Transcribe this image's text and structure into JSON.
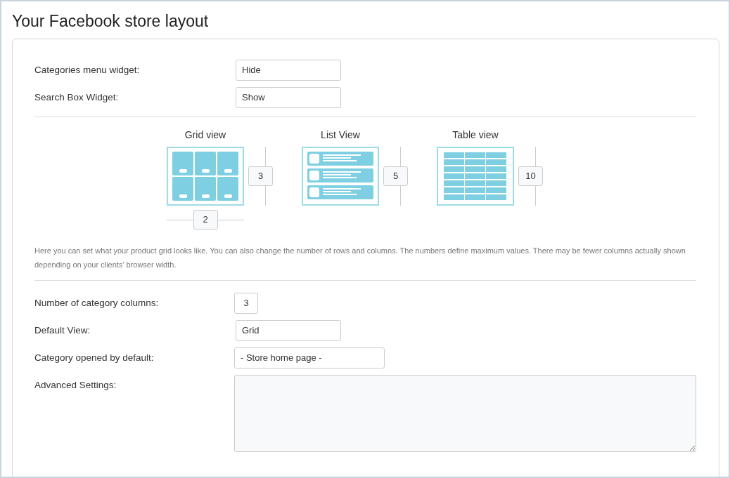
{
  "title": "Your Facebook store layout",
  "widgets": [
    {
      "label": "Categories menu widget:",
      "value": "Hide"
    },
    {
      "label": "Search Box Widget:",
      "value": "Show"
    }
  ],
  "views": [
    {
      "kind": "grid",
      "label": "Grid view",
      "side_value": "3",
      "bottom_value": "2"
    },
    {
      "kind": "list",
      "label": "List View",
      "side_value": "5"
    },
    {
      "kind": "table",
      "label": "Table view",
      "side_value": "10"
    }
  ],
  "description": "Here you can set what your product grid looks like. You can also change the number of rows and columns. The numbers define maximum values. There may be fewer columns actually shown depending on your clients' browser width.",
  "settings": [
    {
      "kind": "number",
      "label": "Number of category columns:",
      "value": "3"
    },
    {
      "kind": "select",
      "label": "Default View:",
      "value": "Grid"
    },
    {
      "kind": "wide-select",
      "label": "Category opened by default:",
      "value": "- Store home page -"
    },
    {
      "kind": "textarea",
      "label": "Advanced Settings:"
    }
  ]
}
